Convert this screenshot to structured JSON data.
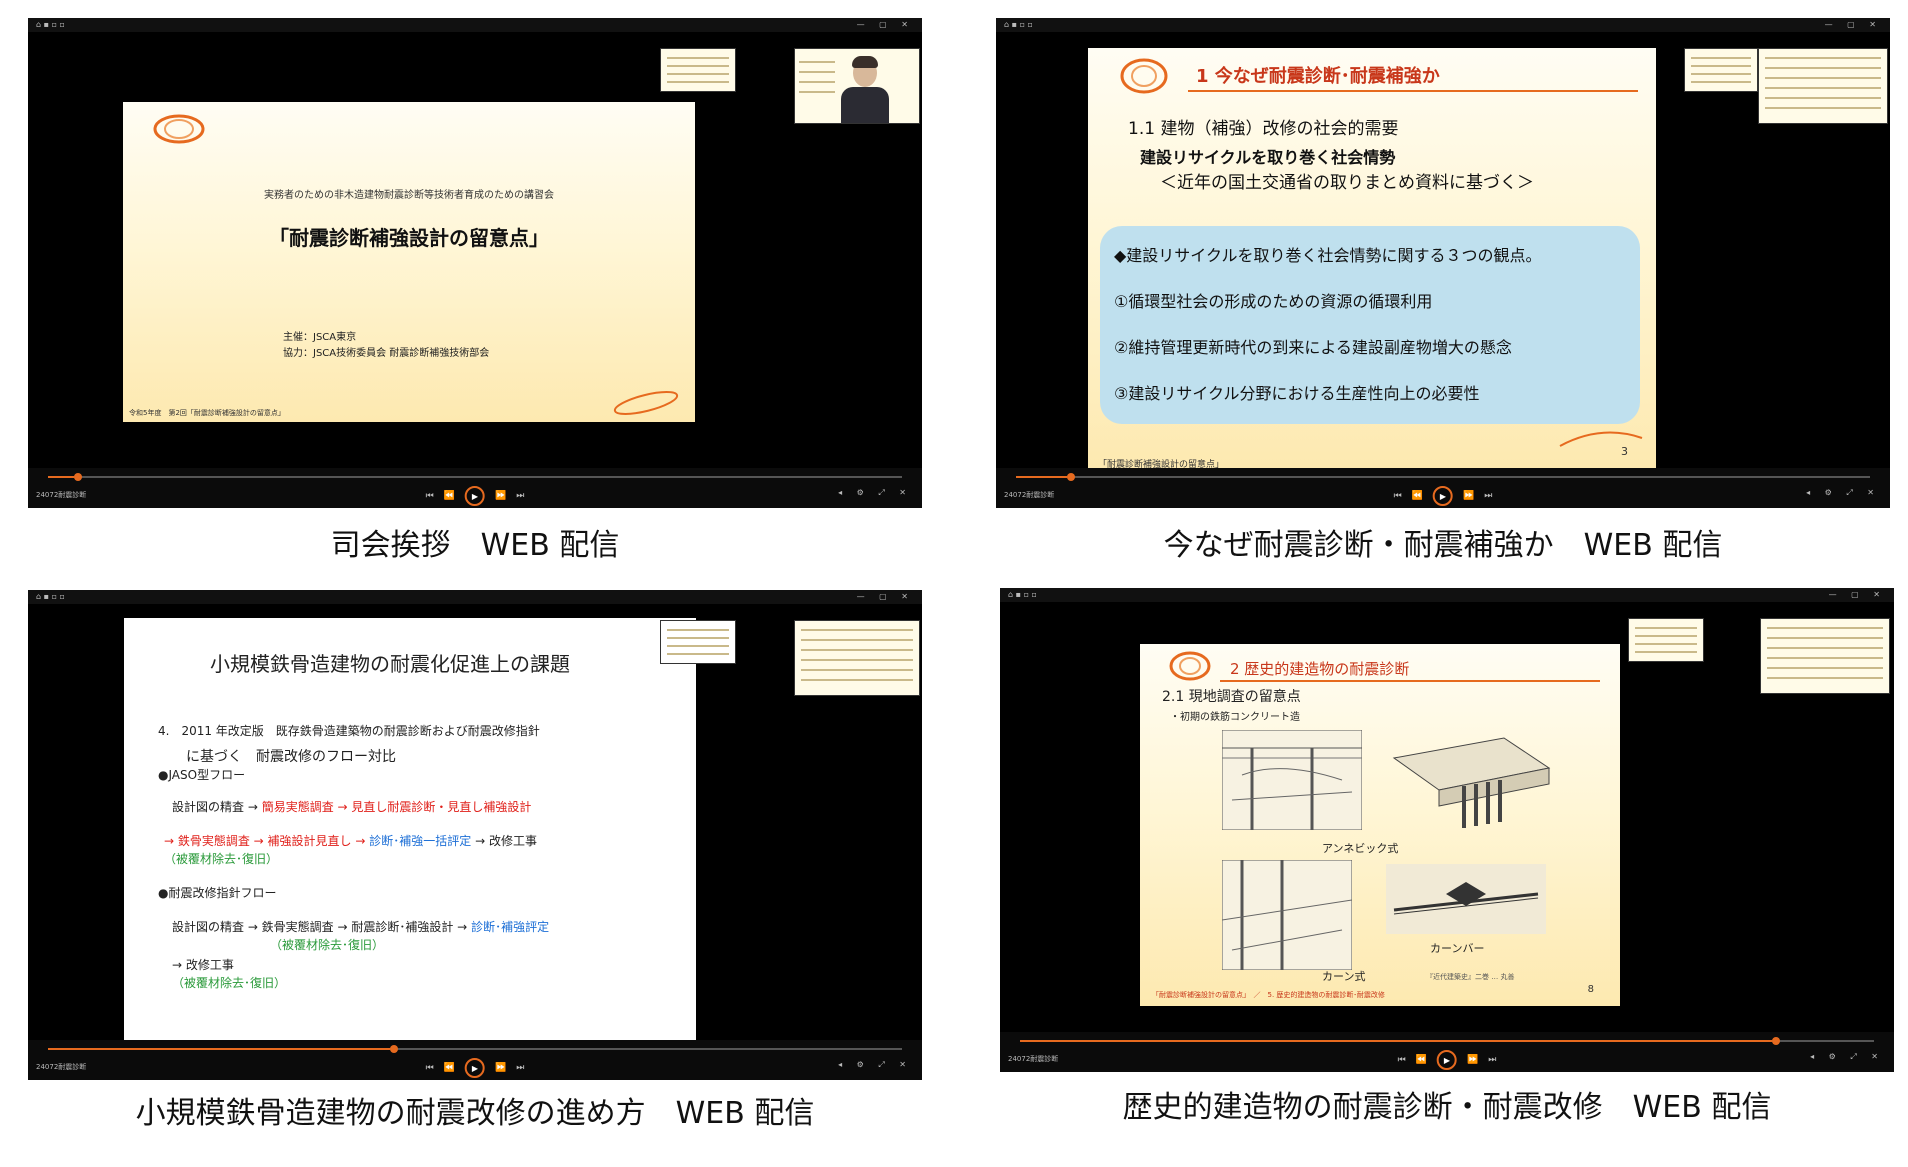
{
  "panels": [
    {
      "caption": "司会挨拶　WEB 配信",
      "slide": {
        "subtitle": "実務者のための非木造建物耐震診断等技術者育成のための講習会",
        "title": "「耐震診断補強設計の留意点」",
        "org1": "主催：JSCA東京",
        "org2": "協力：JSCA技術委員会 耐震診断補強技術部会",
        "footer": "令和5年度　第2回「耐震診断補強設計の留意点」"
      }
    },
    {
      "caption": "今なぜ耐震診断・耐震補強か　WEB 配信",
      "slide": {
        "heading": "1  今なぜ耐震診断･耐震補強か",
        "section": "1.1  建物（補強）改修の社会的需要",
        "bold": "建設リサイクルを取り巻く社会情勢",
        "sub": "＜近年の国土交通省の取りまとめ資料に基づく＞",
        "box": [
          "◆建設リサイクルを取り巻く社会情勢に関する３つの観点。",
          "①循環型社会の形成のための資源の循環利用",
          "②維持管理更新時代の到来による建設副産物増大の懸念",
          "③建設リサイクル分野における生産性向上の必要性"
        ],
        "page": "3",
        "footer": "「耐震診断補強設計の留意点」"
      }
    },
    {
      "caption": "小規模鉄骨造建物の耐震改修の進め方　WEB 配信",
      "slide": {
        "title": "小規模鉄骨造建物の耐震化促進上の課題",
        "item4a": "4.　2011 年改定版　既存鉄骨造建築物の耐震診断および耐震改修指針",
        "item4b": "に基づく　耐震改修のフロー対比",
        "jaso": "●JASO型フロー",
        "flow1_pre": "設計図の精査 →",
        "flow1_red": "簡易実態調査 → 見直し耐震診断・見直し補強設計",
        "flow2_red": "→ 鉄骨実態調査 → 補強設計見直し →",
        "flow2_blue": "診断･補強一括評定",
        "flow2_post": "→ 改修工事",
        "flow2_green": "（被覆材除去･復旧）",
        "guide": "●耐震改修指針フロー",
        "flow3_pre": "設計図の精査 → 鉄骨実態調査 → 耐震診断･補強設計 →",
        "flow3_blue": "診断･補強評定",
        "flow3_green": "（被覆材除去･復旧）",
        "flow4": "→ 改修工事",
        "flow4_green": "（被覆材除去･復旧）"
      }
    },
    {
      "caption": "歴史的建造物の耐震診断・耐震改修　WEB 配信",
      "slide": {
        "heading": "2  歴史的建造物の耐震診断",
        "section": "2.1  現地調査の留意点",
        "bullet": "・初期の鉄筋コンクリート造",
        "fig1": "アンネビック式",
        "fig2": "カーンバー",
        "fig3": "カーン式",
        "credit": "『近代建築史』二巻 … 丸善",
        "footer": "「耐震診断補強設計の留意点」　／　5. 歴史的建造物の耐震診断･耐震改修",
        "page": "8"
      }
    }
  ],
  "player": {
    "label": "24072耐震診断",
    "controls": [
      "⏮",
      "⏪",
      "▶",
      "⏩",
      "⏭"
    ]
  },
  "colors": {
    "accent": "#e66a1f",
    "heading_red": "#c8371a",
    "flow_red": "#e0201a",
    "flow_blue": "#1d6fd6",
    "flow_green": "#2a9a3a",
    "box_blue": "#bfe0ee"
  }
}
